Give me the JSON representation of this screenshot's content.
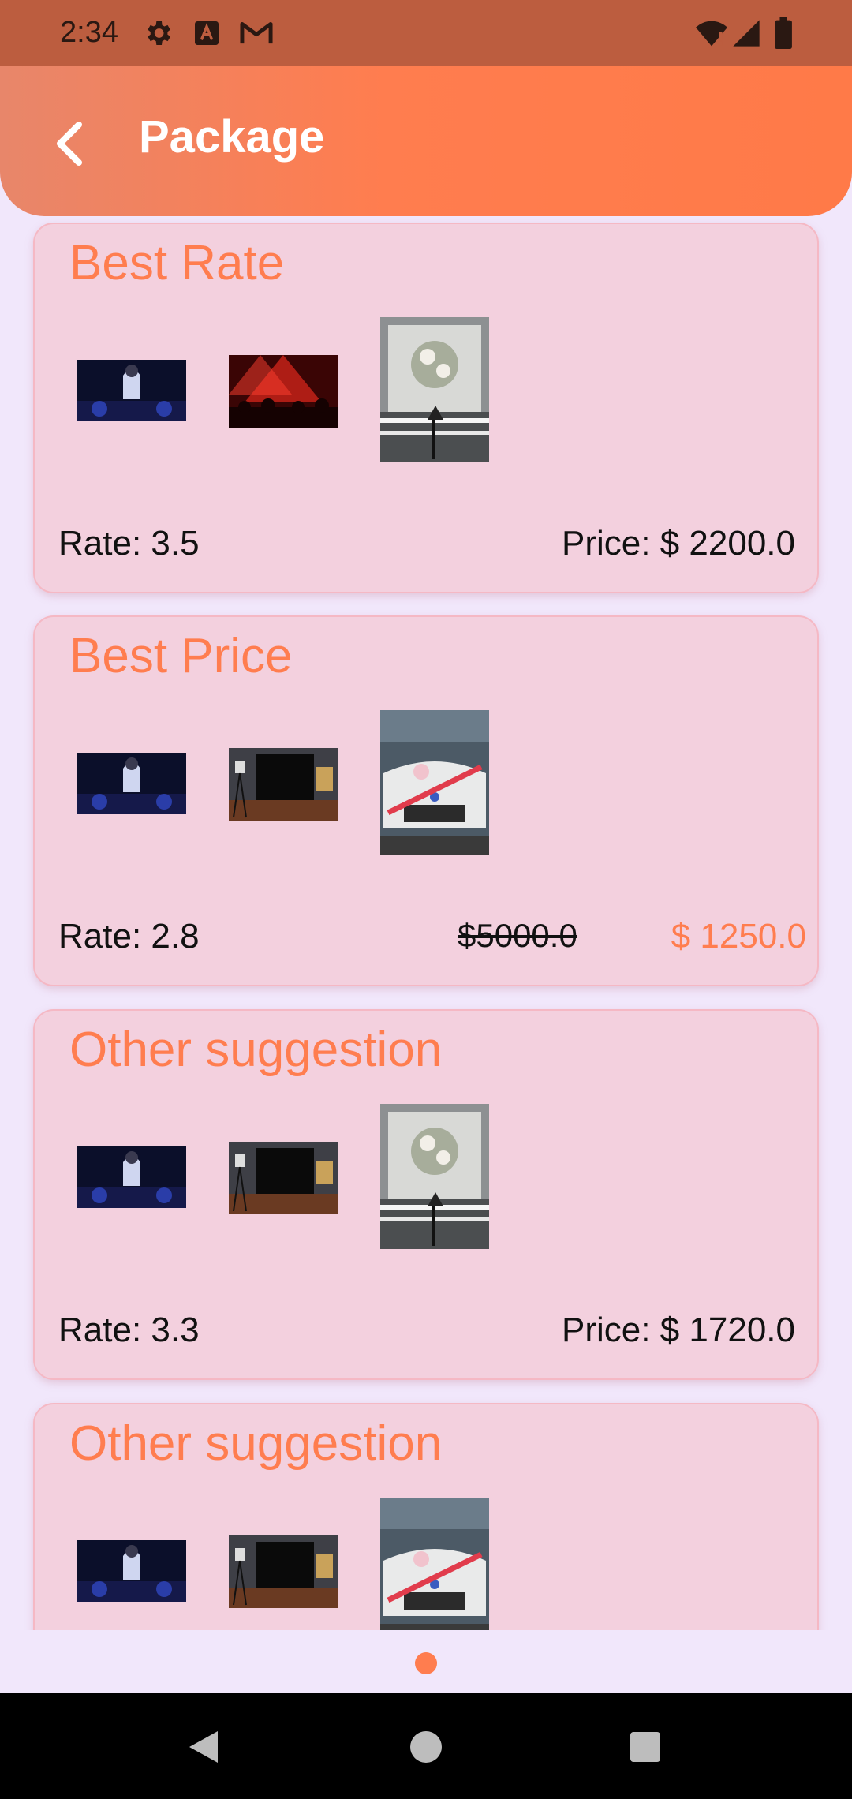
{
  "status_bar": {
    "time": "2:34",
    "icons": [
      "settings-icon",
      "a-box-icon",
      "gmail-icon",
      "wifi-icon",
      "signal-icon",
      "battery-icon"
    ]
  },
  "header": {
    "title": "Package",
    "back_icon": "chevron-left-icon"
  },
  "cards": [
    {
      "title": "Best Rate",
      "rate": "Rate: 3.5",
      "price": "Price: $ 2200.0",
      "images": [
        "dj-image",
        "concert-image",
        "wedding-decor-image"
      ]
    },
    {
      "title": "Best Price",
      "rate": "Rate: 2.8",
      "old_price": "$5000.0",
      "new_price": "$ 1250.0",
      "images": [
        "dj-image",
        "studio-image",
        "wedding-car-image"
      ]
    },
    {
      "title": "Other suggestion",
      "rate": "Rate: 3.3",
      "price": "Price: $ 1720.0",
      "images": [
        "dj-image",
        "studio-image",
        "wedding-decor-image"
      ]
    },
    {
      "title": "Other suggestion",
      "images": [
        "dj-image",
        "studio-image",
        "wedding-car-image"
      ]
    }
  ],
  "colors": {
    "accent": "#FF7D4F",
    "card_bg": "#F3D0DE",
    "status_bar": "#BC5D3F",
    "page_bg": "#F1E7FB"
  },
  "pager": {
    "count": 1,
    "active": 0
  }
}
